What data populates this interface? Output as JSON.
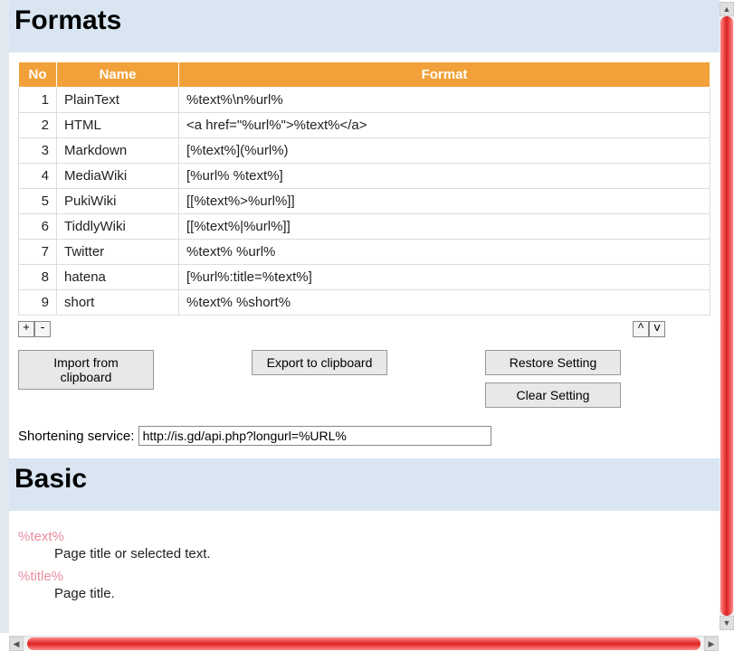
{
  "headings": {
    "formats": "Formats",
    "basic": "Basic"
  },
  "table": {
    "headers": {
      "no": "No",
      "name": "Name",
      "format": "Format"
    },
    "rows": [
      {
        "no": "1",
        "name": "PlainText",
        "format": "%text%\\n%url%"
      },
      {
        "no": "2",
        "name": "HTML",
        "format": "<a href=\"%url%\">%text%</a>"
      },
      {
        "no": "3",
        "name": "Markdown",
        "format": "[%text%](%url%)"
      },
      {
        "no": "4",
        "name": "MediaWiki",
        "format": "[%url% %text%]"
      },
      {
        "no": "5",
        "name": "PukiWiki",
        "format": "[[%text%>%url%]]"
      },
      {
        "no": "6",
        "name": "TiddlyWiki",
        "format": "[[%text%|%url%]]"
      },
      {
        "no": "7",
        "name": "Twitter",
        "format": "%text% %url%"
      },
      {
        "no": "8",
        "name": "hatena",
        "format": "[%url%:title=%text%]"
      },
      {
        "no": "9",
        "name": "short",
        "format": "%text% %short%"
      }
    ]
  },
  "buttons": {
    "add": "+",
    "remove": "-",
    "move_up": "^",
    "move_down": "v",
    "import_clipboard": "Import from clipboard",
    "export_clipboard": "Export to clipboard",
    "restore_setting": "Restore Setting",
    "clear_setting": "Clear Setting"
  },
  "shortening": {
    "label": "Shortening service:",
    "value": "http://is.gd/api.php?longurl=%URL%"
  },
  "basic_defs": [
    {
      "term": "%text%",
      "desc": "Page title or selected text."
    },
    {
      "term": "%title%",
      "desc": "Page title."
    }
  ]
}
